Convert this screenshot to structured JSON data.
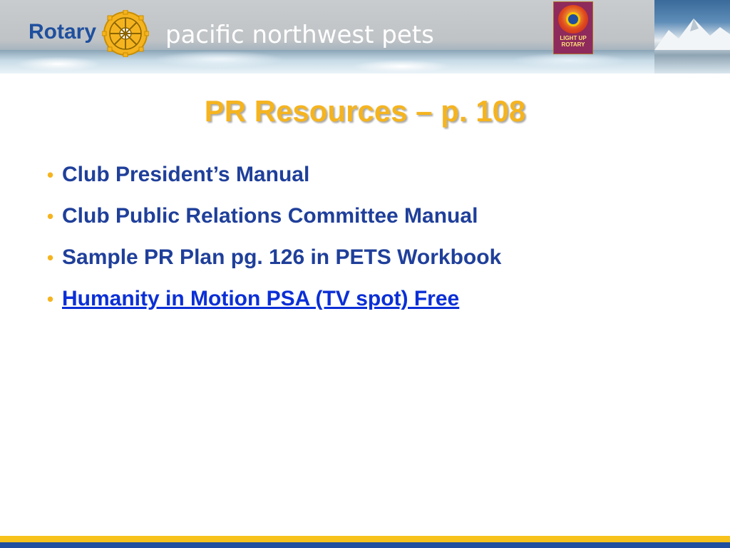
{
  "header": {
    "brand": "Rotary",
    "title": "pacific northwest pets",
    "badge_line1": "LIGHT UP",
    "badge_line2": "ROTARY"
  },
  "slide": {
    "title": "PR Resources – p. 108",
    "bullet_glyph": "•",
    "bullets": [
      "Club President’s Manual",
      "Club Public Relations Committee Manual",
      "Sample PR Plan pg. 126 in PETS Workbook",
      "Humanity in Motion PSA (TV spot) Free"
    ]
  },
  "colors": {
    "title": "#f5b41f",
    "bullet_text": "#1f3f9a",
    "link": "#0b2fd6",
    "rotary_blue": "#1f4f9e",
    "rotary_gold": "#f7c21b"
  }
}
